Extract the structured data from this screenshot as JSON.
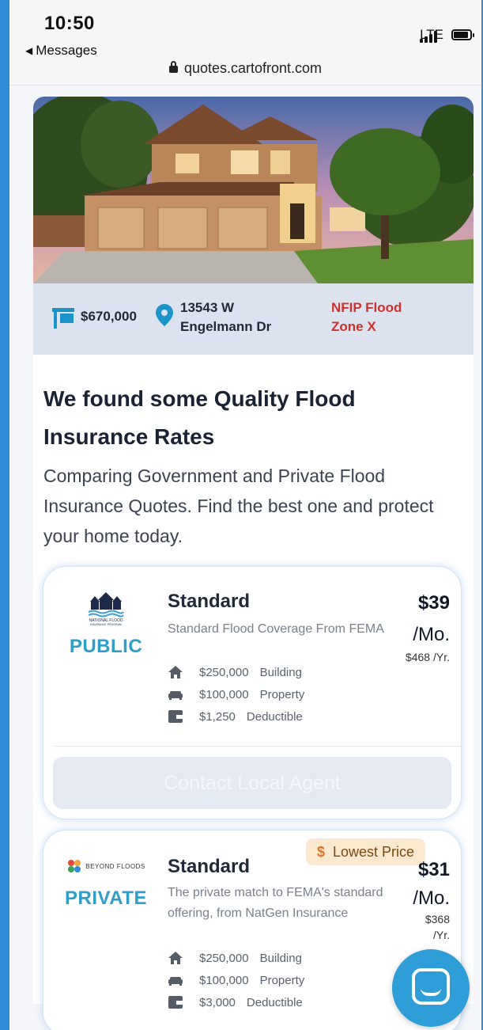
{
  "status_bar": {
    "time": "10:50",
    "back_label": "Messages",
    "network": "LTE",
    "url": "quotes.cartofront.com"
  },
  "property": {
    "price": "$670,000",
    "address_line1": "13543 W",
    "address_line2": "Engelmann Dr",
    "zone_line1": "NFIP Flood",
    "zone_line2": "Zone X"
  },
  "intro": {
    "headline": "We found some Quality Flood Insurance Rates",
    "subtext": "Comparing Government and Private Flood Insurance Quotes. Find the best one and protect your home today."
  },
  "quotes": [
    {
      "logo_text": "NATIONAL FLOOD INSURANCE PROGRAM",
      "type": "PUBLIC",
      "plan": "Standard",
      "description": "Standard Flood Coverage From FEMA",
      "features": [
        {
          "icon": "house-icon",
          "value": "$250,000",
          "label": "Building"
        },
        {
          "icon": "couch-icon",
          "value": "$100,000",
          "label": "Property"
        },
        {
          "icon": "wallet-icon",
          "value": "$1,250",
          "label": "Deductible"
        }
      ],
      "amount": "$39",
      "per_month": "/Mo.",
      "per_year": "$468 /Yr.",
      "cta": "Contact Local Agent"
    },
    {
      "logo_text": "BEYOND FLOODS",
      "type": "PRIVATE",
      "plan": "Standard",
      "description": "The private match to FEMA's standard offering, from NatGen Insurance",
      "features": [
        {
          "icon": "house-icon",
          "value": "$250,000",
          "label": "Building"
        },
        {
          "icon": "couch-icon",
          "value": "$100,000",
          "label": "Property"
        },
        {
          "icon": "wallet-icon",
          "value": "$3,000",
          "label": "Deductible"
        }
      ],
      "amount": "$31",
      "per_month": "/Mo.",
      "per_year_line1": "$368",
      "per_year_line2": "/Yr.",
      "badge": "Lowest Price"
    }
  ],
  "colors": {
    "accent": "#2f9ec8",
    "zone_red": "#d0312d",
    "frame_blue": "#2f8bd6",
    "chat_blue": "#2f9ed8"
  }
}
